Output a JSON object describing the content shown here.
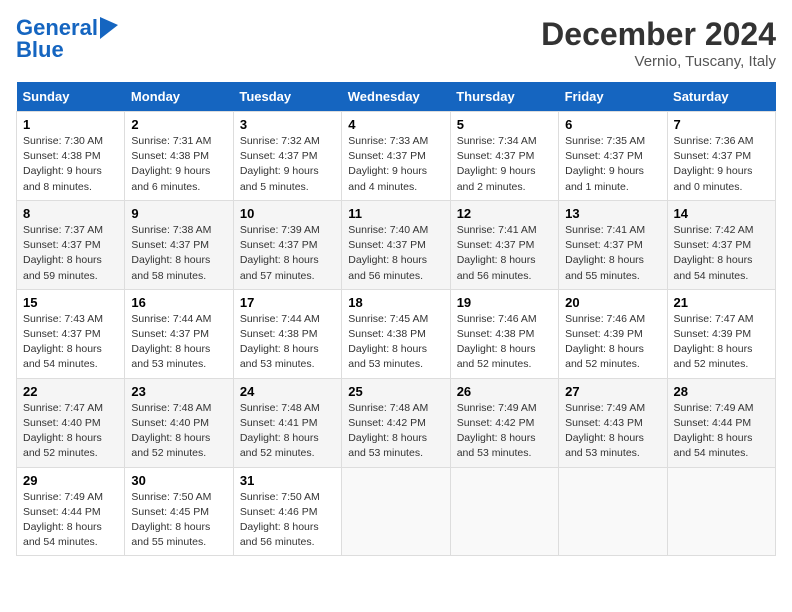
{
  "logo": {
    "line1": "General",
    "line2": "Blue"
  },
  "title": "December 2024",
  "subtitle": "Vernio, Tuscany, Italy",
  "headers": [
    "Sunday",
    "Monday",
    "Tuesday",
    "Wednesday",
    "Thursday",
    "Friday",
    "Saturday"
  ],
  "weeks": [
    [
      {
        "day": "1",
        "info": "Sunrise: 7:30 AM\nSunset: 4:38 PM\nDaylight: 9 hours\nand 8 minutes."
      },
      {
        "day": "2",
        "info": "Sunrise: 7:31 AM\nSunset: 4:38 PM\nDaylight: 9 hours\nand 6 minutes."
      },
      {
        "day": "3",
        "info": "Sunrise: 7:32 AM\nSunset: 4:37 PM\nDaylight: 9 hours\nand 5 minutes."
      },
      {
        "day": "4",
        "info": "Sunrise: 7:33 AM\nSunset: 4:37 PM\nDaylight: 9 hours\nand 4 minutes."
      },
      {
        "day": "5",
        "info": "Sunrise: 7:34 AM\nSunset: 4:37 PM\nDaylight: 9 hours\nand 2 minutes."
      },
      {
        "day": "6",
        "info": "Sunrise: 7:35 AM\nSunset: 4:37 PM\nDaylight: 9 hours\nand 1 minute."
      },
      {
        "day": "7",
        "info": "Sunrise: 7:36 AM\nSunset: 4:37 PM\nDaylight: 9 hours\nand 0 minutes."
      }
    ],
    [
      {
        "day": "8",
        "info": "Sunrise: 7:37 AM\nSunset: 4:37 PM\nDaylight: 8 hours\nand 59 minutes."
      },
      {
        "day": "9",
        "info": "Sunrise: 7:38 AM\nSunset: 4:37 PM\nDaylight: 8 hours\nand 58 minutes."
      },
      {
        "day": "10",
        "info": "Sunrise: 7:39 AM\nSunset: 4:37 PM\nDaylight: 8 hours\nand 57 minutes."
      },
      {
        "day": "11",
        "info": "Sunrise: 7:40 AM\nSunset: 4:37 PM\nDaylight: 8 hours\nand 56 minutes."
      },
      {
        "day": "12",
        "info": "Sunrise: 7:41 AM\nSunset: 4:37 PM\nDaylight: 8 hours\nand 56 minutes."
      },
      {
        "day": "13",
        "info": "Sunrise: 7:41 AM\nSunset: 4:37 PM\nDaylight: 8 hours\nand 55 minutes."
      },
      {
        "day": "14",
        "info": "Sunrise: 7:42 AM\nSunset: 4:37 PM\nDaylight: 8 hours\nand 54 minutes."
      }
    ],
    [
      {
        "day": "15",
        "info": "Sunrise: 7:43 AM\nSunset: 4:37 PM\nDaylight: 8 hours\nand 54 minutes."
      },
      {
        "day": "16",
        "info": "Sunrise: 7:44 AM\nSunset: 4:37 PM\nDaylight: 8 hours\nand 53 minutes."
      },
      {
        "day": "17",
        "info": "Sunrise: 7:44 AM\nSunset: 4:38 PM\nDaylight: 8 hours\nand 53 minutes."
      },
      {
        "day": "18",
        "info": "Sunrise: 7:45 AM\nSunset: 4:38 PM\nDaylight: 8 hours\nand 53 minutes."
      },
      {
        "day": "19",
        "info": "Sunrise: 7:46 AM\nSunset: 4:38 PM\nDaylight: 8 hours\nand 52 minutes."
      },
      {
        "day": "20",
        "info": "Sunrise: 7:46 AM\nSunset: 4:39 PM\nDaylight: 8 hours\nand 52 minutes."
      },
      {
        "day": "21",
        "info": "Sunrise: 7:47 AM\nSunset: 4:39 PM\nDaylight: 8 hours\nand 52 minutes."
      }
    ],
    [
      {
        "day": "22",
        "info": "Sunrise: 7:47 AM\nSunset: 4:40 PM\nDaylight: 8 hours\nand 52 minutes."
      },
      {
        "day": "23",
        "info": "Sunrise: 7:48 AM\nSunset: 4:40 PM\nDaylight: 8 hours\nand 52 minutes."
      },
      {
        "day": "24",
        "info": "Sunrise: 7:48 AM\nSunset: 4:41 PM\nDaylight: 8 hours\nand 52 minutes."
      },
      {
        "day": "25",
        "info": "Sunrise: 7:48 AM\nSunset: 4:42 PM\nDaylight: 8 hours\nand 53 minutes."
      },
      {
        "day": "26",
        "info": "Sunrise: 7:49 AM\nSunset: 4:42 PM\nDaylight: 8 hours\nand 53 minutes."
      },
      {
        "day": "27",
        "info": "Sunrise: 7:49 AM\nSunset: 4:43 PM\nDaylight: 8 hours\nand 53 minutes."
      },
      {
        "day": "28",
        "info": "Sunrise: 7:49 AM\nSunset: 4:44 PM\nDaylight: 8 hours\nand 54 minutes."
      }
    ],
    [
      {
        "day": "29",
        "info": "Sunrise: 7:49 AM\nSunset: 4:44 PM\nDaylight: 8 hours\nand 54 minutes."
      },
      {
        "day": "30",
        "info": "Sunrise: 7:50 AM\nSunset: 4:45 PM\nDaylight: 8 hours\nand 55 minutes."
      },
      {
        "day": "31",
        "info": "Sunrise: 7:50 AM\nSunset: 4:46 PM\nDaylight: 8 hours\nand 56 minutes."
      },
      null,
      null,
      null,
      null
    ]
  ]
}
